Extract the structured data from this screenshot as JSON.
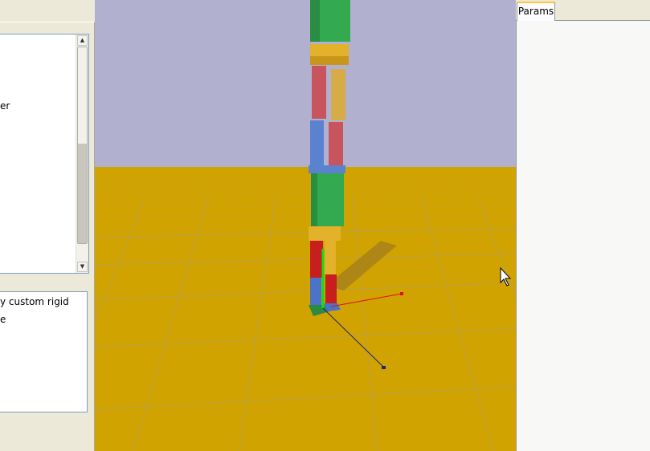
{
  "left_panel": {
    "top_list": {
      "items": [
        "er"
      ]
    },
    "scrollbar": {
      "up_arrow": "▲",
      "down_arrow": "▼"
    },
    "bottom_list": {
      "items": [
        "y custom rigid",
        "e"
      ]
    }
  },
  "viewport": {
    "sky_color": "#b1b1cf",
    "ground_color": "#d1a300",
    "grid_color": "#b7a04c",
    "gizmo_x_color": "#e21010",
    "gizmo_y_color": "#12e012",
    "gizmo_z_color": "#22227a",
    "body_colors": {
      "green": "#33aa50",
      "yellow": "#e3b12a",
      "red": "#c8545e",
      "blue": "#5b82cf"
    }
  },
  "right_panel": {
    "tabs": [
      {
        "label": "Params"
      }
    ]
  }
}
